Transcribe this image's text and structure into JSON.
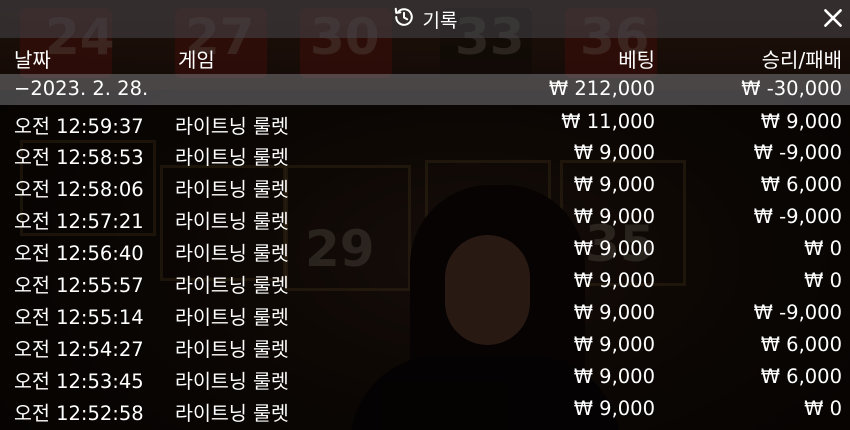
{
  "header": {
    "title": "기록",
    "history_icon": "history-icon",
    "close_icon": "close-icon"
  },
  "columns": {
    "date": "날짜",
    "game": "게임",
    "bet": "베팅",
    "win_loss": "승리/패배"
  },
  "summary": {
    "date": "−2023. 2. 28.",
    "bet": "₩ 212,000",
    "win_loss": "₩ -30,000"
  },
  "rows": [
    {
      "time": "오전 12:59:37",
      "game": "라이트닝 룰렛",
      "bet": "₩ 11,000",
      "win_loss": "₩ 9,000"
    },
    {
      "time": "오전 12:58:53",
      "game": "라이트닝 룰렛",
      "bet": "₩ 9,000",
      "win_loss": "₩ -9,000"
    },
    {
      "time": "오전 12:58:06",
      "game": "라이트닝 룰렛",
      "bet": "₩ 9,000",
      "win_loss": "₩ 6,000"
    },
    {
      "time": "오전 12:57:21",
      "game": "라이트닝 룰렛",
      "bet": "₩ 9,000",
      "win_loss": "₩ -9,000"
    },
    {
      "time": "오전 12:56:40",
      "game": "라이트닝 룰렛",
      "bet": "₩ 9,000",
      "win_loss": "₩ 0"
    },
    {
      "time": "오전 12:55:57",
      "game": "라이트닝 룰렛",
      "bet": "₩ 9,000",
      "win_loss": "₩ 0"
    },
    {
      "time": "오전 12:55:14",
      "game": "라이트닝 룰렛",
      "bet": "₩ 9,000",
      "win_loss": "₩ -9,000"
    },
    {
      "time": "오전 12:54:27",
      "game": "라이트닝 룰렛",
      "bet": "₩ 9,000",
      "win_loss": "₩ 6,000"
    },
    {
      "time": "오전 12:53:45",
      "game": "라이트닝 룰렛",
      "bet": "₩ 9,000",
      "win_loss": "₩ 6,000"
    },
    {
      "time": "오전 12:52:58",
      "game": "라이트닝 룰렛",
      "bet": "₩ 9,000",
      "win_loss": "₩ 0"
    }
  ],
  "background_numbers": [
    "24",
    "27",
    "30",
    "33",
    "36",
    "29",
    "35"
  ]
}
